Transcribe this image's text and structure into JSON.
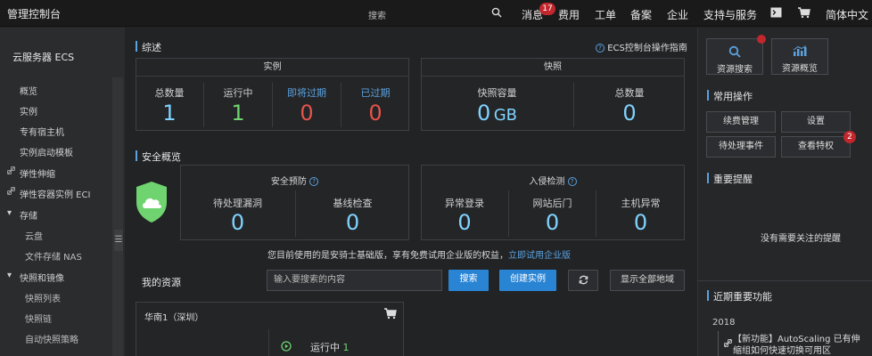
{
  "topbar": {
    "brand": "管理控制台",
    "search_label": "搜索",
    "nav": [
      "消息",
      "费用",
      "工单",
      "备案",
      "企业",
      "支持与服务",
      "简体中文"
    ],
    "message_count": "17"
  },
  "sidebar": {
    "title": "云服务器 ECS",
    "items": [
      "概览",
      "实例",
      "专有宿主机",
      "实例启动模板",
      "弹性伸缩",
      "弹性容器实例 ECI",
      "存储",
      "云盘",
      "文件存储 NAS",
      "快照和镜像",
      "快照列表",
      "快照链",
      "自动快照策略"
    ]
  },
  "overview": {
    "title": "综述",
    "guide_link": "ECS控制台操作指南",
    "instances": {
      "title": "实例",
      "stats": [
        {
          "label": "总数量",
          "value": "1"
        },
        {
          "label": "运行中",
          "value": "1"
        },
        {
          "label": "即将过期",
          "value": "0"
        },
        {
          "label": "已过期",
          "value": "0"
        }
      ]
    },
    "snapshots": {
      "title": "快照",
      "capacity_label": "快照容量",
      "capacity_value": "0",
      "capacity_unit": "GB",
      "count_label": "总数量",
      "count_value": "0"
    }
  },
  "security": {
    "title": "安全概览",
    "warning": {
      "title": "安全预防",
      "stats": [
        {
          "label": "待处理漏洞",
          "value": "0"
        },
        {
          "label": "基线检查",
          "value": "0"
        }
      ]
    },
    "intrusion": {
      "title": "入侵检测",
      "stats": [
        {
          "label": "异常登录",
          "value": "0"
        },
        {
          "label": "网站后门",
          "value": "0"
        },
        {
          "label": "主机异常",
          "value": "0"
        }
      ]
    },
    "notice": "您目前使用的是安骑士基础版，享有免费试用企业版的权益，",
    "notice_link": "立即试用企业版"
  },
  "resources": {
    "title": "我的资源",
    "search_placeholder": "输入要搜索的内容",
    "search_button": "搜索",
    "create_button": "创建实例",
    "show_all_button": "显示全部地域",
    "region": "华南1（深圳）",
    "running_label": "运行中",
    "running_count": "1"
  },
  "right": {
    "resource_search": "资源搜索",
    "resource_overview": "资源概览",
    "common_ops_title": "常用操作",
    "ops": [
      "续费管理",
      "设置",
      "待处理事件",
      "查看特权"
    ],
    "privilege_badge": "2",
    "reminder_title": "重要提醒",
    "reminder_empty": "没有需要关注的提醒",
    "features_title": "近期重要功能",
    "year": "2018",
    "feature_text_1": "【新功能】AutoScaling 已有伸",
    "feature_text_2": "缩组如何快速切换可用区"
  },
  "colors": {
    "accent_blue": "#5aa2e0",
    "green": "#6fd36f",
    "red": "#e5534b",
    "cyan": "#7fd3ff"
  }
}
